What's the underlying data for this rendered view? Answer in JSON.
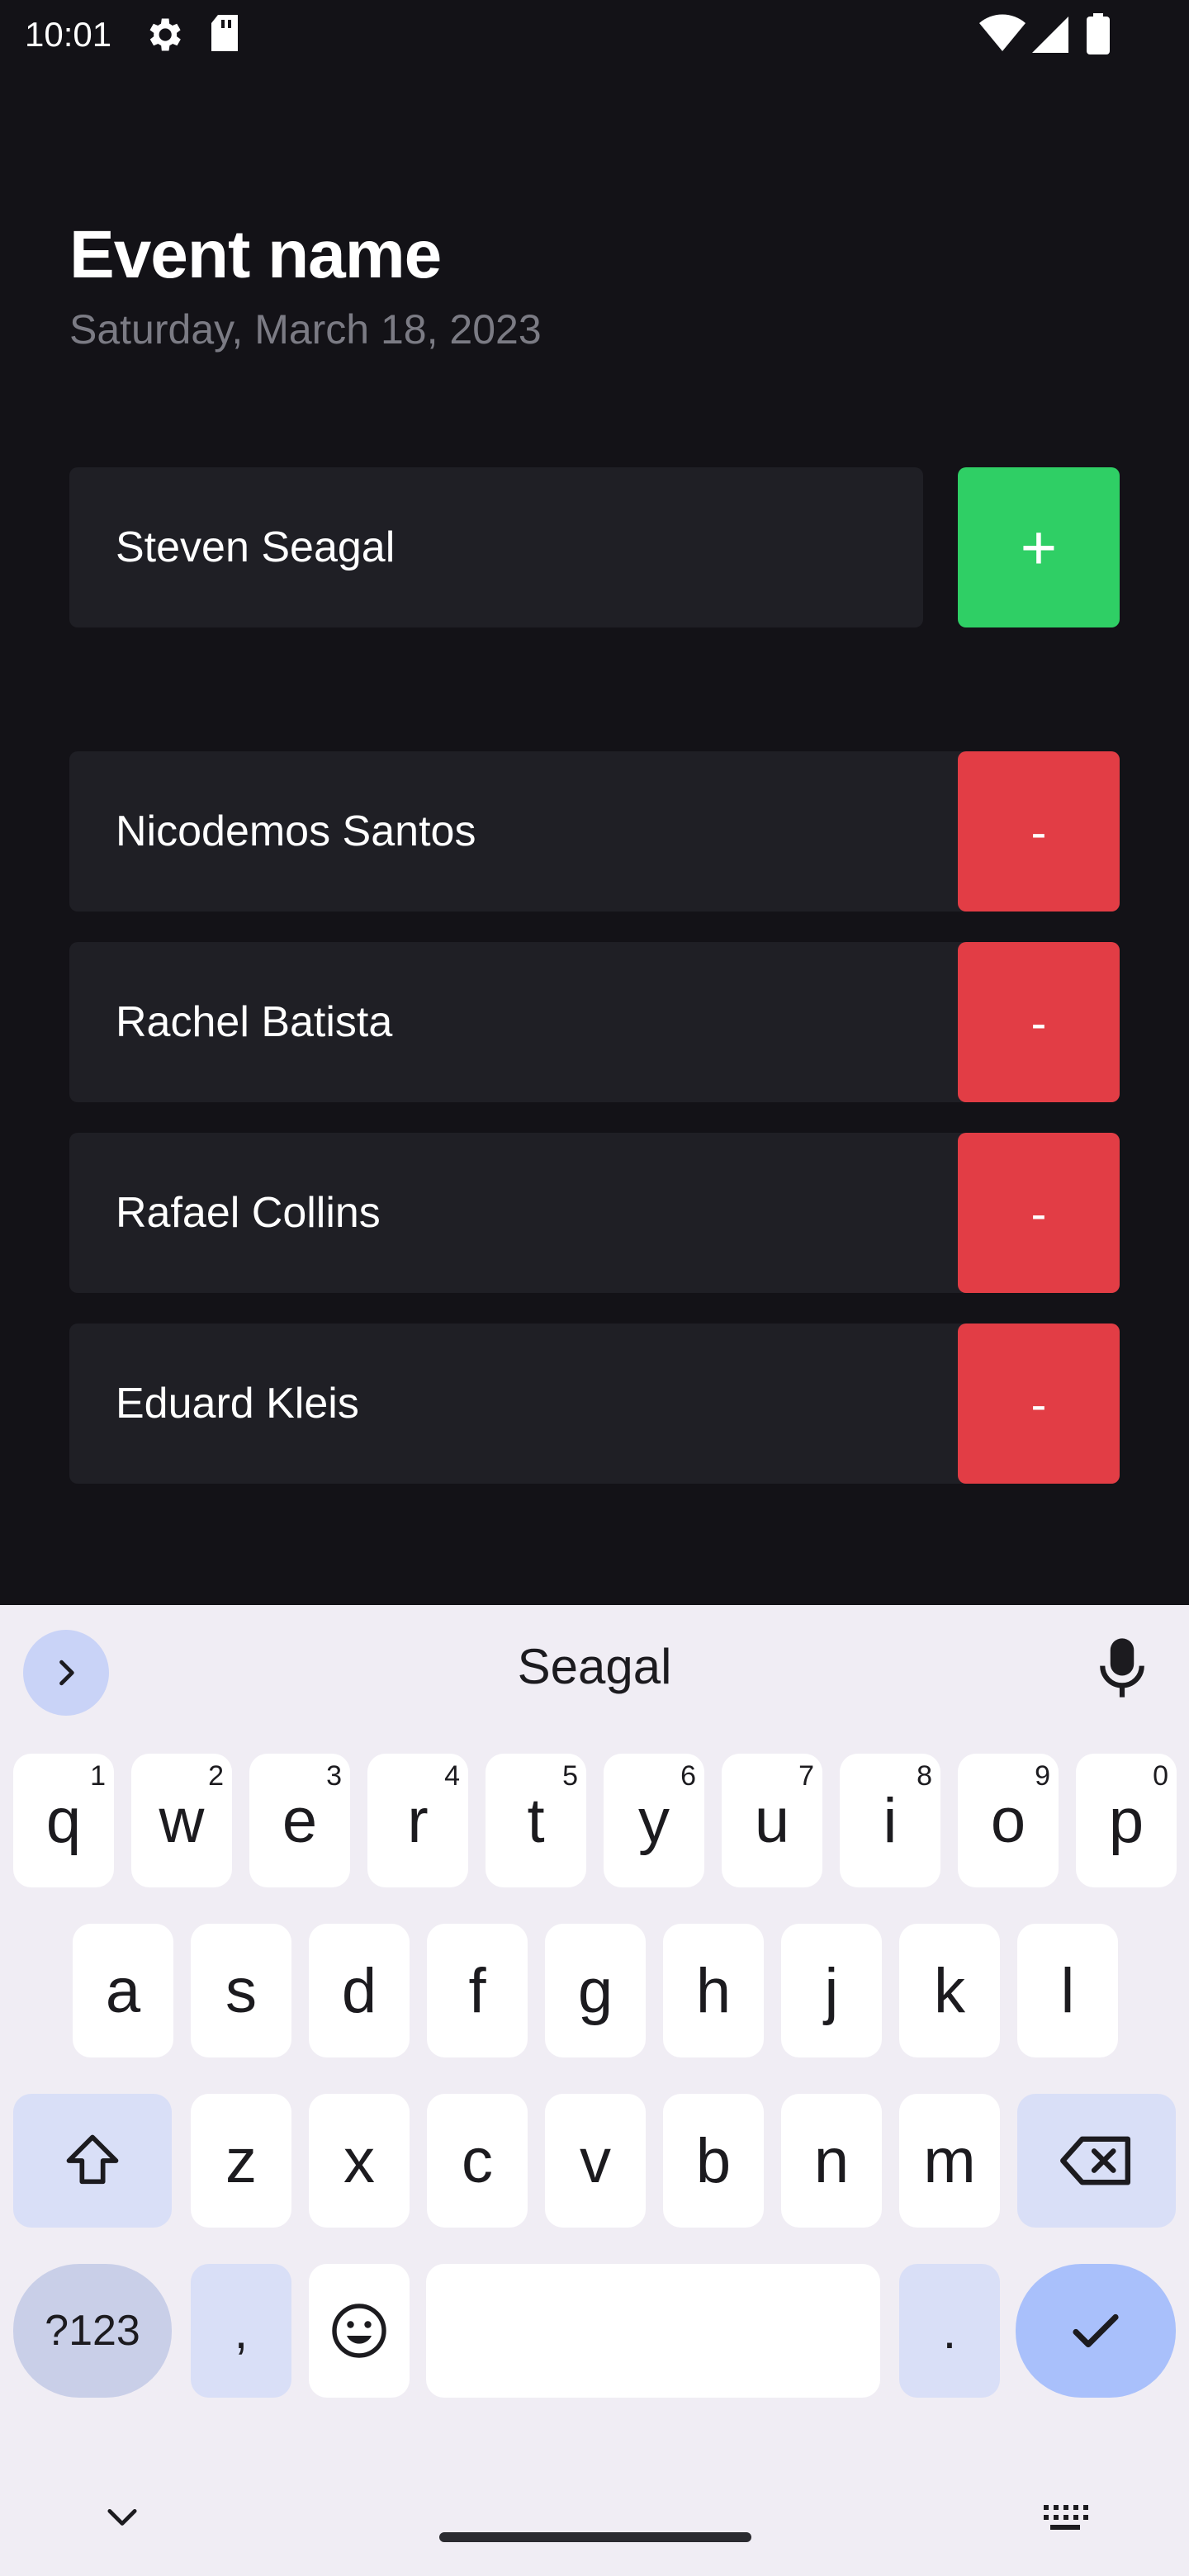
{
  "status_bar": {
    "time": "10:01",
    "icons": [
      "settings-icon",
      "sd-card-icon",
      "wifi-icon",
      "signal-icon",
      "battery-icon"
    ]
  },
  "event": {
    "title": "Event name",
    "date": "Saturday, March 18, 2023"
  },
  "add_form": {
    "input_value": "Steven Seagal",
    "add_label": "+"
  },
  "participants": [
    {
      "name": "Nicodemos Santos",
      "remove_label": "-"
    },
    {
      "name": "Rachel Batista",
      "remove_label": "-"
    },
    {
      "name": "Rafael Collins",
      "remove_label": "-"
    },
    {
      "name": "Eduard Kleis",
      "remove_label": "-"
    }
  ],
  "keyboard": {
    "suggestion": "Seagal",
    "row1": [
      {
        "k": "q",
        "h": "1"
      },
      {
        "k": "w",
        "h": "2"
      },
      {
        "k": "e",
        "h": "3"
      },
      {
        "k": "r",
        "h": "4"
      },
      {
        "k": "t",
        "h": "5"
      },
      {
        "k": "y",
        "h": "6"
      },
      {
        "k": "u",
        "h": "7"
      },
      {
        "k": "i",
        "h": "8"
      },
      {
        "k": "o",
        "h": "9"
      },
      {
        "k": "p",
        "h": "0"
      }
    ],
    "row2": [
      "a",
      "s",
      "d",
      "f",
      "g",
      "h",
      "j",
      "k",
      "l"
    ],
    "row3": [
      "z",
      "x",
      "c",
      "v",
      "b",
      "n",
      "m"
    ],
    "sym_label": "?123",
    "comma": ",",
    "period": "."
  },
  "colors": {
    "background": "#131217",
    "card": "#1f1f25",
    "add": "#2fcf65",
    "remove": "#e23d45",
    "keyboard_bg": "#f0edf4"
  }
}
